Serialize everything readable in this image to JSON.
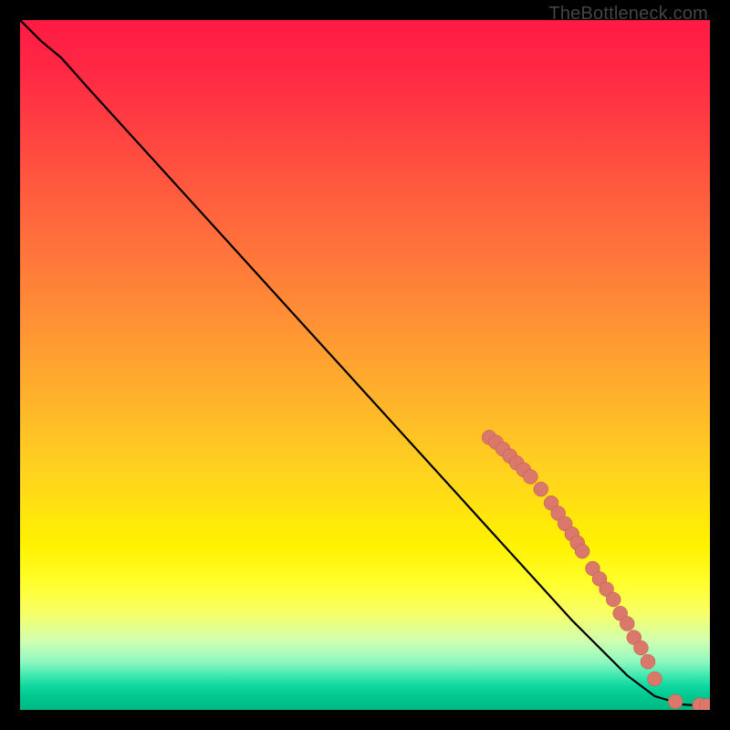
{
  "watermark": "TheBottleneck.com",
  "chart_data": {
    "type": "line",
    "title": "",
    "xlabel": "",
    "ylabel": "",
    "xlim": [
      0,
      100
    ],
    "ylim": [
      0,
      100
    ],
    "curve": [
      {
        "x": 0,
        "y": 100
      },
      {
        "x": 3,
        "y": 97
      },
      {
        "x": 6,
        "y": 94.5
      },
      {
        "x": 10,
        "y": 90
      },
      {
        "x": 20,
        "y": 79
      },
      {
        "x": 30,
        "y": 68
      },
      {
        "x": 40,
        "y": 57
      },
      {
        "x": 50,
        "y": 46
      },
      {
        "x": 60,
        "y": 35
      },
      {
        "x": 70,
        "y": 24
      },
      {
        "x": 80,
        "y": 13
      },
      {
        "x": 88,
        "y": 5
      },
      {
        "x": 92,
        "y": 2
      },
      {
        "x": 96,
        "y": 0.8
      },
      {
        "x": 100,
        "y": 0.5
      }
    ],
    "scatter_points": [
      {
        "x": 68,
        "y": 39.5
      },
      {
        "x": 69,
        "y": 38.8
      },
      {
        "x": 70,
        "y": 37.8
      },
      {
        "x": 71,
        "y": 36.8
      },
      {
        "x": 72,
        "y": 35.8
      },
      {
        "x": 73,
        "y": 34.8
      },
      {
        "x": 74,
        "y": 33.8
      },
      {
        "x": 75.5,
        "y": 32
      },
      {
        "x": 77,
        "y": 30
      },
      {
        "x": 78,
        "y": 28.5
      },
      {
        "x": 79,
        "y": 27
      },
      {
        "x": 80,
        "y": 25.5
      },
      {
        "x": 80.8,
        "y": 24.2
      },
      {
        "x": 81.5,
        "y": 23
      },
      {
        "x": 83,
        "y": 20.5
      },
      {
        "x": 84,
        "y": 19
      },
      {
        "x": 85,
        "y": 17.5
      },
      {
        "x": 86,
        "y": 16
      },
      {
        "x": 87,
        "y": 14
      },
      {
        "x": 88,
        "y": 12.5
      },
      {
        "x": 89,
        "y": 10.5
      },
      {
        "x": 90,
        "y": 9
      },
      {
        "x": 91,
        "y": 7
      },
      {
        "x": 92,
        "y": 4.5
      },
      {
        "x": 95,
        "y": 1.2
      },
      {
        "x": 98.5,
        "y": 0.7
      },
      {
        "x": 99.5,
        "y": 0.6
      }
    ],
    "colors": {
      "curve": "#000000",
      "point_fill": "#d9786b",
      "point_stroke": "#c05a4a"
    }
  }
}
